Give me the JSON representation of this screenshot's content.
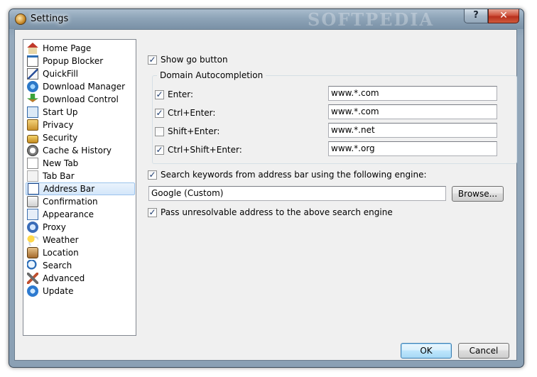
{
  "window": {
    "title": "Settings",
    "watermark": "SOFTPEDIA",
    "help_label": "?",
    "close_label": "✕"
  },
  "sidebar": {
    "items": [
      {
        "label": "Home Page",
        "icon": "home-icon"
      },
      {
        "label": "Popup Blocker",
        "icon": "popup-blocker-icon"
      },
      {
        "label": "QuickFill",
        "icon": "quickfill-icon"
      },
      {
        "label": "Download Manager",
        "icon": "download-manager-icon"
      },
      {
        "label": "Download Control",
        "icon": "download-control-icon"
      },
      {
        "label": "Start Up",
        "icon": "startup-icon"
      },
      {
        "label": "Privacy",
        "icon": "privacy-icon"
      },
      {
        "label": "Security",
        "icon": "lock-icon"
      },
      {
        "label": "Cache & History",
        "icon": "history-icon"
      },
      {
        "label": "New Tab",
        "icon": "new-tab-icon"
      },
      {
        "label": "Tab Bar",
        "icon": "tab-bar-icon"
      },
      {
        "label": "Address Bar",
        "icon": "address-bar-icon",
        "selected": true
      },
      {
        "label": "Confirmation",
        "icon": "confirmation-icon"
      },
      {
        "label": "Appearance",
        "icon": "appearance-icon"
      },
      {
        "label": "Proxy",
        "icon": "proxy-icon"
      },
      {
        "label": "Weather",
        "icon": "weather-icon"
      },
      {
        "label": "Location",
        "icon": "location-icon"
      },
      {
        "label": "Search",
        "icon": "search-icon"
      },
      {
        "label": "Advanced",
        "icon": "advanced-icon"
      },
      {
        "label": "Update",
        "icon": "update-icon"
      }
    ]
  },
  "main": {
    "show_go_button": {
      "label": "Show go button",
      "checked": true
    },
    "domain_group": {
      "title": "Domain Autocompletion",
      "rows": [
        {
          "label": "Enter:",
          "checked": true,
          "value": "www.*.com"
        },
        {
          "label": "Ctrl+Enter:",
          "checked": true,
          "value": "www.*.com"
        },
        {
          "label": "Shift+Enter:",
          "checked": false,
          "value": "www.*.net"
        },
        {
          "label": "Ctrl+Shift+Enter:",
          "checked": true,
          "value": "www.*.org"
        }
      ]
    },
    "search_keywords": {
      "label": "Search keywords from address bar using the following engine:",
      "checked": true
    },
    "engine": {
      "value": "Google (Custom)",
      "browse_label": "Browse..."
    },
    "pass_unresolvable": {
      "label": "Pass unresolvable address to the above search engine",
      "checked": true
    }
  },
  "footer": {
    "ok_label": "OK",
    "cancel_label": "Cancel"
  },
  "colors": {
    "selection_bg": "#d3e6fa",
    "selection_border": "#9bc3ec",
    "check_mark": "#1c3b6f"
  }
}
